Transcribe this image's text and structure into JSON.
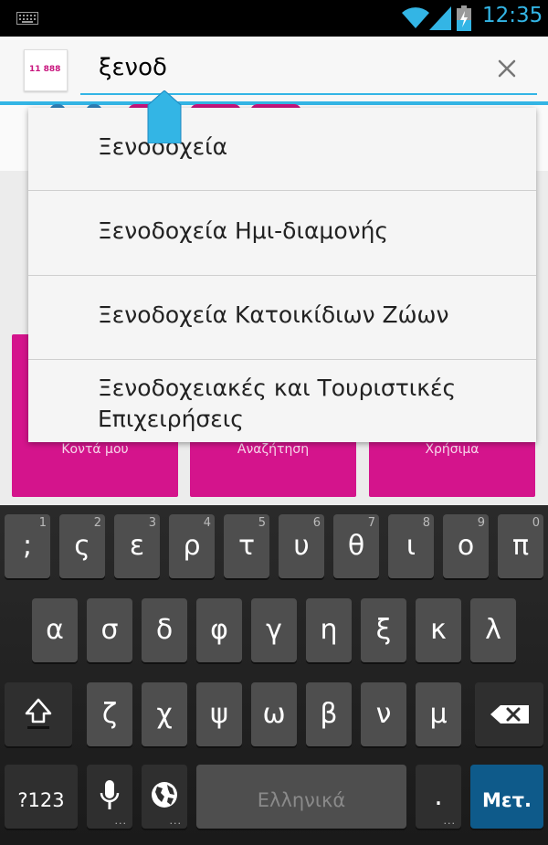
{
  "status_bar": {
    "time": "12:35",
    "icons": [
      "keyboard-notification-icon",
      "wifi-icon",
      "cell-signal-icon",
      "battery-charging-icon"
    ]
  },
  "search": {
    "query": "ξενοδ",
    "app_logo_text": "11 888"
  },
  "background": {
    "tiles": [
      {
        "label": "Κοντά μου"
      },
      {
        "label": "Αναζήτηση"
      },
      {
        "label": "Χρήσιμα"
      }
    ]
  },
  "suggestions": [
    "Ξενοδοχεία",
    "Ξενοδοχεία Ημι-διαμονής",
    "Ξενοδοχεία Κατοικίδιων Ζώων",
    "Ξενοδοχειακές και Τουριστικές Επιχειρήσεις"
  ],
  "keyboard": {
    "row1": [
      {
        "ch": ";",
        "hint": "1"
      },
      {
        "ch": "ς",
        "hint": "2"
      },
      {
        "ch": "ε",
        "hint": "3"
      },
      {
        "ch": "ρ",
        "hint": "4"
      },
      {
        "ch": "τ",
        "hint": "5"
      },
      {
        "ch": "υ",
        "hint": "6"
      },
      {
        "ch": "θ",
        "hint": "7"
      },
      {
        "ch": "ι",
        "hint": "8"
      },
      {
        "ch": "ο",
        "hint": "9"
      },
      {
        "ch": "π",
        "hint": "0"
      }
    ],
    "row2": [
      "α",
      "σ",
      "δ",
      "φ",
      "γ",
      "η",
      "ξ",
      "κ",
      "λ"
    ],
    "row3": [
      "ζ",
      "χ",
      "ψ",
      "ω",
      "β",
      "ν",
      "μ"
    ],
    "symbols_label": "?123",
    "space_label": "Ελληνικά",
    "period_label": ".",
    "enter_label": "Μετ."
  },
  "colors": {
    "accent": "#33b5e5",
    "brand": "#d4148c",
    "enter_key": "#0e5a8a"
  }
}
